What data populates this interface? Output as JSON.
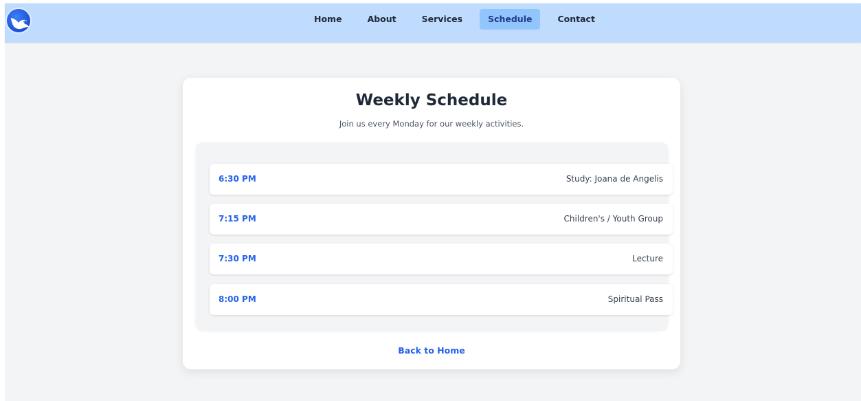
{
  "nav": {
    "logo_icon": "dove-icon",
    "links": [
      "Home",
      "About",
      "Services",
      "Schedule",
      "Contact"
    ],
    "active": "Schedule"
  },
  "schedule": {
    "title": "Weekly Schedule",
    "subtitle": "Join us every Monday for our weekly activities.",
    "items": [
      {
        "time": "6:30 PM",
        "activity": "Study: Joana de Angelis"
      },
      {
        "time": "7:15 PM",
        "activity": "Children's / Youth Group"
      },
      {
        "time": "7:30 PM",
        "activity": "Lecture"
      },
      {
        "time": "8:00 PM",
        "activity": "Spiritual Pass"
      }
    ],
    "back_link": "Back to Home"
  },
  "colors": {
    "navbar_bg": "#bfdbfe",
    "active_tab_bg": "#93c5fd",
    "accent": "#2563eb",
    "page_bg": "#f3f4f6"
  }
}
